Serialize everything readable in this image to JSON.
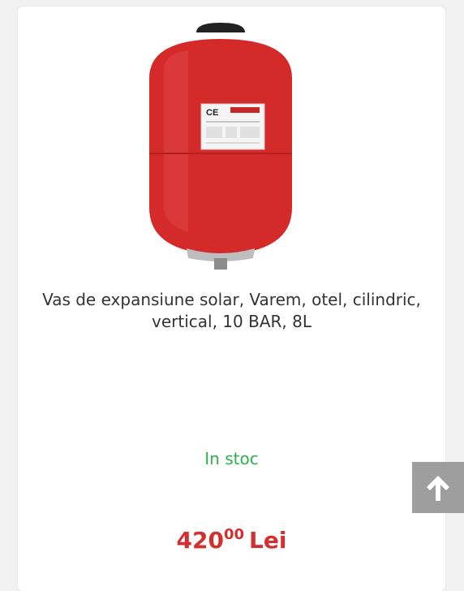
{
  "product": {
    "title": "Vas de expansiune solar, Varem, otel, cilindric, vertical, 10 BAR, 8L",
    "stock": "In stoc",
    "price_main": "420",
    "price_cents": "00",
    "currency": "Lei",
    "image_icon": "expansion-vessel-image"
  },
  "ui": {
    "scroll_top_icon": "arrow-up-icon"
  },
  "colors": {
    "stock": "#2bb24c",
    "price": "#d32f2f",
    "vessel": "#d42a2a",
    "scroll_button": "#9e9e9e"
  }
}
